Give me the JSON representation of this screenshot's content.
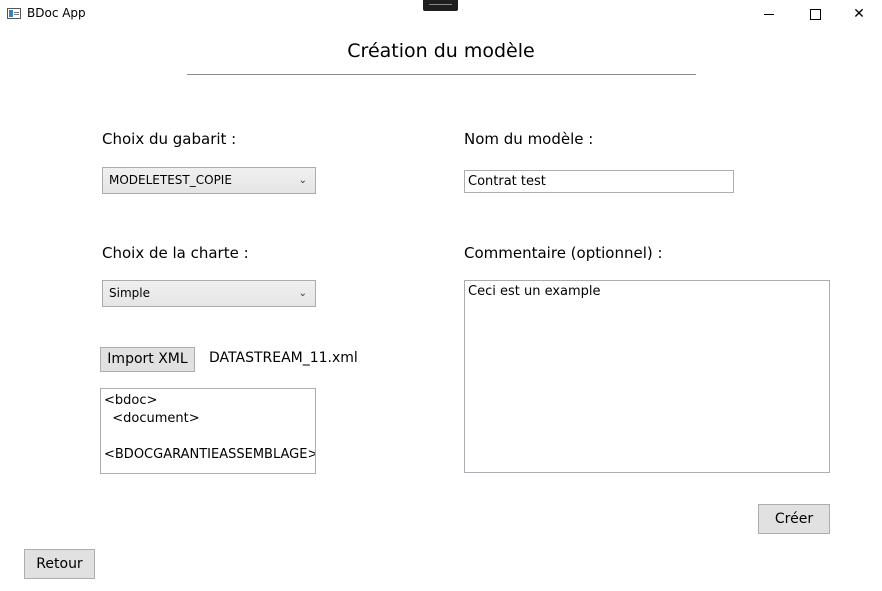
{
  "window": {
    "title": "BDoc App",
    "minimize_symbol": "",
    "close_symbol": "✕"
  },
  "page": {
    "title": "Création du modèle"
  },
  "gabarit": {
    "label": "Choix du gabarit :",
    "selected": "MODELETEST_COPIE"
  },
  "charte": {
    "label": "Choix de la charte :",
    "selected": "Simple"
  },
  "import": {
    "button_label": "Import XML",
    "file_name": "DATASTREAM_11.xml",
    "preview_lines": [
      "<bdoc>",
      "  <document>",
      "",
      "<BDOCGARANTIEASSEMBLAGE>"
    ]
  },
  "model_name": {
    "label": "Nom du modèle :",
    "value": "Contrat test"
  },
  "comment": {
    "label": "Commentaire (optionnel) :",
    "value": "Ceci est un example"
  },
  "actions": {
    "create_label": "Créer",
    "back_label": "Retour"
  }
}
